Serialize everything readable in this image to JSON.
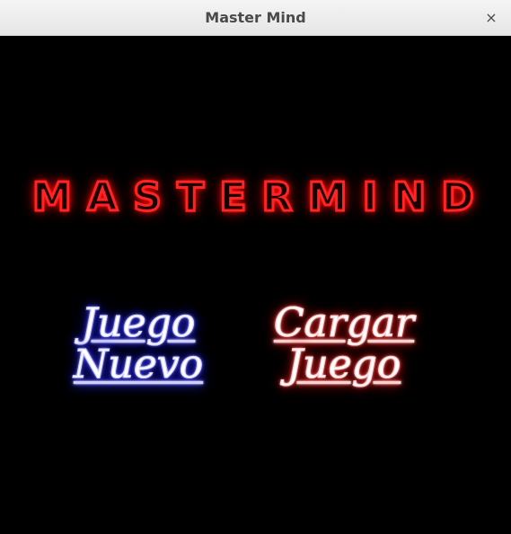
{
  "window": {
    "title": "Master Mind",
    "close_label": "×"
  },
  "logo": {
    "letters": [
      "M",
      "A",
      "S",
      "T",
      "E",
      "R",
      "M",
      "I",
      "N",
      "D"
    ],
    "color": "#ff2323"
  },
  "buttons": {
    "new_game": {
      "line1": "Juego",
      "line2": "Nuevo",
      "glow_color": "#2a2aff"
    },
    "load_game": {
      "line1": "Cargar",
      "line2": "Juego",
      "glow_color": "#e61a1a"
    }
  },
  "colors": {
    "background": "#000000",
    "titlebar": "#ececec",
    "title_text": "#4a4a4a"
  }
}
